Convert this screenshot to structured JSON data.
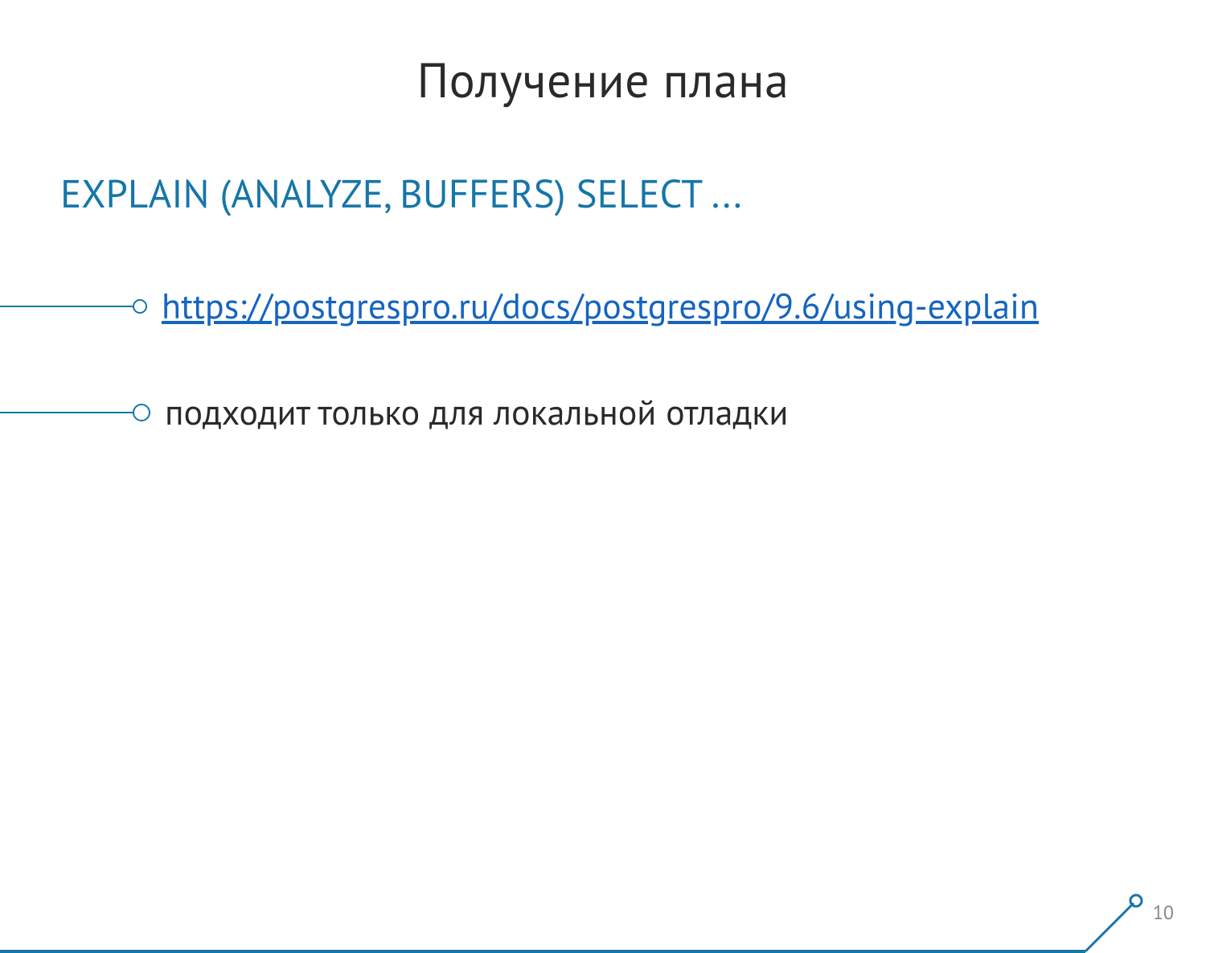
{
  "title": "Получение плана",
  "subtitle": "EXPLAIN (ANALYZE, BUFFERS) SELECT ...",
  "bullets": [
    {
      "text": "https://postgrespro.ru/docs/postgrespro/9.6/using-explain",
      "isLink": true
    },
    {
      "text": "подходит только для локальной отладки",
      "isLink": false
    }
  ],
  "pageNumber": "10"
}
